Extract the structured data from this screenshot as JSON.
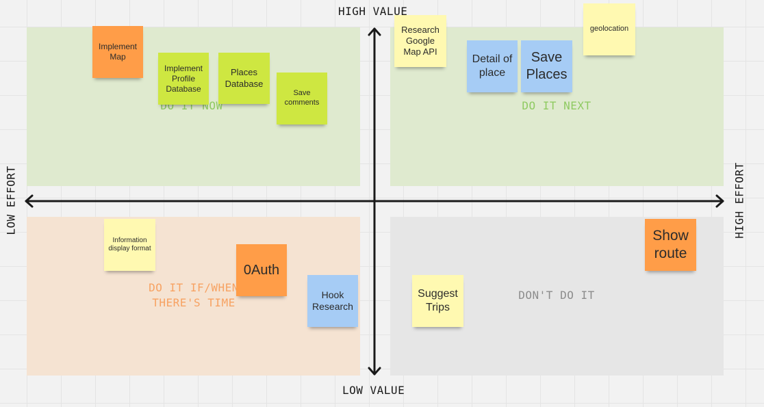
{
  "axes": {
    "top": "HIGH VALUE",
    "bottom": "LOW VALUE",
    "left": "LOW EFFORT",
    "right": "HIGH EFFORT"
  },
  "quadrants": {
    "top_left": "DO IT NOW",
    "top_right": "DO IT NEXT",
    "bottom_left": "DO IT IF/WHEN THERE'S TIME",
    "bottom_right": "DON'T DO IT"
  },
  "notes": {
    "implement_map": "Implement Map",
    "implement_profile_database": "Implement Profile Database",
    "places_database": "Places Database",
    "save_comments": "Save comments",
    "research_google_map_api": "Research Google Map API",
    "detail_of_place": "Detail of place",
    "save_places": "Save Places",
    "geolocation": "geolocation",
    "information_display_format": "Information display format",
    "oauth": "0Auth",
    "hook_research": "Hook Research",
    "suggest_trips": "Suggest Trips",
    "show_route": "Show route"
  },
  "colors": {
    "orange": "#ff9d48",
    "green": "#cee741",
    "yellow": "#fff9b1",
    "blue": "#a6ccf5",
    "quadrant_green": "#dfeacf",
    "quadrant_peach": "#f5e3d2",
    "quadrant_gray": "#e6e6e6"
  }
}
